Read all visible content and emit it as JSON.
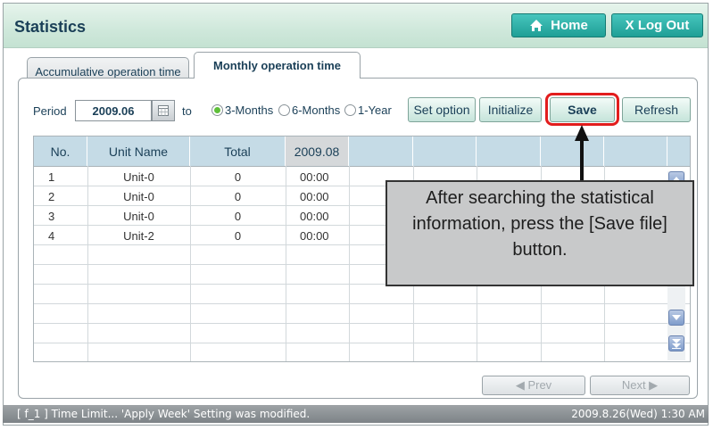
{
  "header": {
    "title": "Statistics",
    "home_label": "Home",
    "logout_label": "X Log Out"
  },
  "tabs": [
    {
      "label": "Accumulative operation time",
      "active": false
    },
    {
      "label": "Monthly operation time",
      "active": true
    }
  ],
  "filter": {
    "period_label": "Period",
    "period_value": "2009.06",
    "to_label": "to",
    "ranges": [
      {
        "label": "3-Months",
        "selected": true
      },
      {
        "label": "6-Months",
        "selected": false
      },
      {
        "label": "1-Year",
        "selected": false
      }
    ]
  },
  "actions": {
    "set_option": "Set option",
    "initialize": "Initialize",
    "save": "Save",
    "refresh": "Refresh"
  },
  "table": {
    "columns": [
      "No.",
      "Unit Name",
      "Total",
      "2009.08",
      "",
      "",
      "",
      "",
      "",
      ""
    ],
    "rows": [
      [
        "1",
        "Unit-0",
        "0",
        "00:00"
      ],
      [
        "2",
        "Unit-0",
        "0",
        "00:00"
      ],
      [
        "3",
        "Unit-0",
        "0",
        "00:00"
      ],
      [
        "4",
        "Unit-2",
        "0",
        "00:00"
      ]
    ]
  },
  "pagination": {
    "prev_label": "◀  Prev",
    "next_label": "Next  ▶"
  },
  "callout": {
    "text": "After searching the statistical information, press the [Save file] button."
  },
  "status": {
    "message": "[ f_1 ] Time Limit... 'Apply Week' Setting was modified.",
    "datetime": "2009.8.26(Wed) 1:30 AM"
  },
  "colors": {
    "accent": "#1f9f96",
    "highlight": "#e21d1d",
    "header_cell": "#c5dbe6"
  }
}
